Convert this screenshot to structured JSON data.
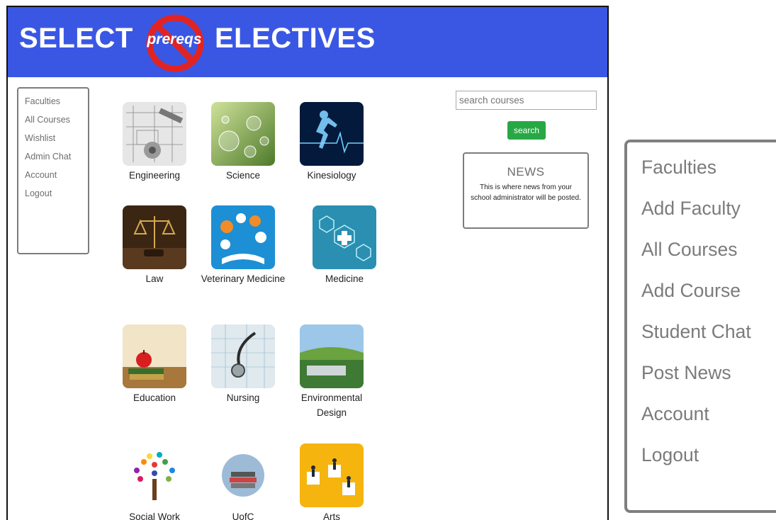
{
  "banner": {
    "title_left": "SELECT",
    "title_right": "ELECTIVES",
    "logo_word": "prereqs",
    "background": "#3a57e4"
  },
  "sidebar": {
    "items": [
      {
        "label": "Faculties"
      },
      {
        "label": "All Courses"
      },
      {
        "label": "Wishlist"
      },
      {
        "label": "Admin Chat"
      },
      {
        "label": "Account"
      },
      {
        "label": "Logout"
      }
    ]
  },
  "faculties": [
    {
      "label": "Engineering",
      "icon": "blueprint-icon"
    },
    {
      "label": "Science",
      "icon": "bubbles-icon"
    },
    {
      "label": "Kinesiology",
      "icon": "runner-icon"
    },
    {
      "label": "Law",
      "icon": "scales-icon"
    },
    {
      "label": "Veterinary Medicine",
      "icon": "vet-book-icon"
    },
    {
      "label": "Medicine",
      "icon": "medical-hexagon-icon"
    },
    {
      "label": "Education",
      "icon": "apple-books-icon"
    },
    {
      "label": "Nursing",
      "icon": "stethoscope-icon"
    },
    {
      "label": "Environmental Design",
      "icon": "green-roof-icon"
    },
    {
      "label": "Social Work",
      "icon": "hand-tree-icon"
    },
    {
      "label": "UofC",
      "icon": "book-stack-icon"
    },
    {
      "label": "Arts",
      "icon": "puzzle-people-icon"
    }
  ],
  "search": {
    "placeholder": "search courses",
    "button_label": "search",
    "button_color": "#27a844"
  },
  "news": {
    "title": "NEWS",
    "body": "This is where news from your school administrator will be posted."
  },
  "admin_menu": {
    "items": [
      {
        "label": "Faculties"
      },
      {
        "label": "Add Faculty"
      },
      {
        "label": "All Courses"
      },
      {
        "label": "Add Course"
      },
      {
        "label": "Student Chat"
      },
      {
        "label": "Post News"
      },
      {
        "label": "Account"
      },
      {
        "label": "Logout"
      }
    ]
  }
}
